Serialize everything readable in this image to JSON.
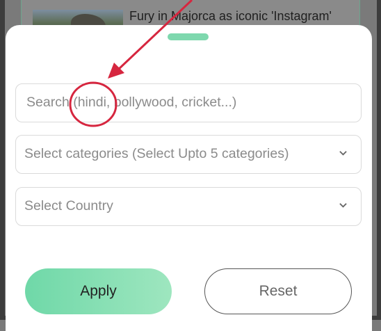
{
  "background_article": {
    "headline": "Fury in Majorca as iconic 'Instagram'"
  },
  "search": {
    "placeholder": "Search (hindi, bollywood, cricket...)"
  },
  "categories": {
    "placeholder": "Select categories (Select Upto 5 categories)"
  },
  "country": {
    "placeholder": "Select Country"
  },
  "buttons": {
    "apply_label": "Apply",
    "reset_label": "Reset"
  },
  "colors": {
    "accent": "#7ed8ae",
    "annotation": "#d6263f"
  }
}
